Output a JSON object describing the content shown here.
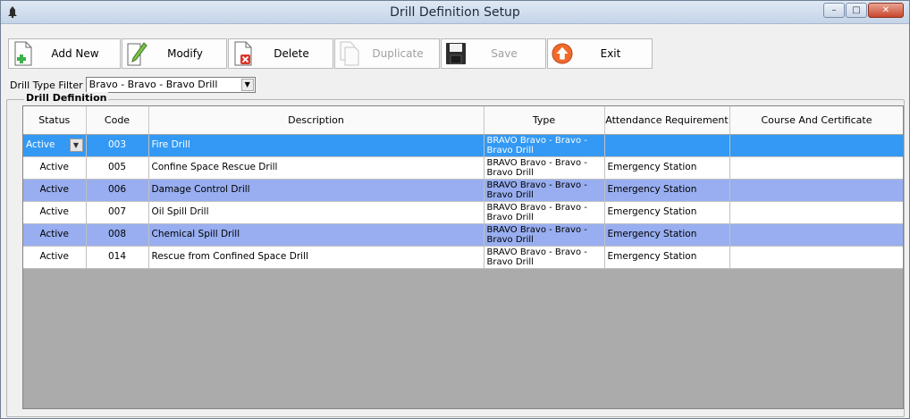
{
  "window": {
    "title": "Drill Definition Setup",
    "controls": {
      "minimize": "–",
      "maximize": "□",
      "close": "✕"
    }
  },
  "toolbar": {
    "add_new": "Add New",
    "modify": "Modify",
    "delete": "Delete",
    "duplicate": "Duplicate",
    "save": "Save",
    "exit": "Exit"
  },
  "filter": {
    "label": "Drill Type Filter",
    "value": "Bravo - Bravo - Bravo Drill"
  },
  "group": {
    "title": "Drill Definition"
  },
  "grid": {
    "columns": [
      "Status",
      "Code",
      "Description",
      "Type",
      "Attendance Requirement",
      "Course And Certificate"
    ],
    "rows": [
      {
        "status": "Active",
        "code": "003",
        "description": "Fire Drill",
        "type": "BRAVO Bravo - Bravo - Bravo Drill",
        "attendance": "",
        "course": ""
      },
      {
        "status": "Active",
        "code": "005",
        "description": "Confine Space Rescue Drill",
        "type": "BRAVO Bravo - Bravo - Bravo Drill",
        "attendance": "Emergency Station",
        "course": ""
      },
      {
        "status": "Active",
        "code": "006",
        "description": "Damage Control Drill",
        "type": "BRAVO Bravo - Bravo - Bravo Drill",
        "attendance": "Emergency Station",
        "course": ""
      },
      {
        "status": "Active",
        "code": "007",
        "description": "Oil Spill Drill",
        "type": "BRAVO Bravo - Bravo - Bravo Drill",
        "attendance": "Emergency Station",
        "course": ""
      },
      {
        "status": "Active",
        "code": "008",
        "description": "Chemical Spill Drill",
        "type": "BRAVO Bravo - Bravo - Bravo Drill",
        "attendance": "Emergency Station",
        "course": ""
      },
      {
        "status": "Active",
        "code": "014",
        "description": "Rescue from Confined Space Drill",
        "type": "BRAVO Bravo - Bravo - Bravo Drill",
        "attendance": "Emergency Station",
        "course": ""
      }
    ]
  },
  "colors": {
    "selected_row": "#3399f4",
    "alternate_row": "#98aef0",
    "grid_background": "#ababab"
  },
  "icons": {
    "add_new": "add-document-icon",
    "modify": "pencil-icon",
    "delete": "delete-document-icon",
    "duplicate": "copy-icon",
    "save": "floppy-disk-icon",
    "exit": "up-arrow-icon"
  }
}
